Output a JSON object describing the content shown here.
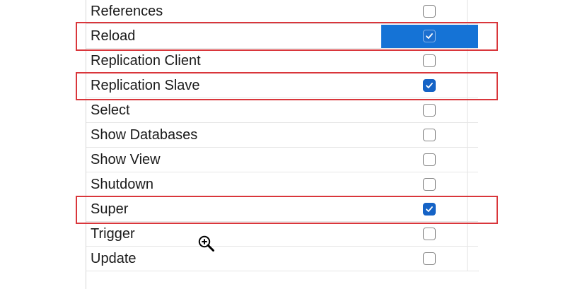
{
  "privileges": {
    "rows": [
      {
        "label": "References",
        "checked": false
      },
      {
        "label": "Reload",
        "checked": true
      },
      {
        "label": "Replication Client",
        "checked": false
      },
      {
        "label": "Replication Slave",
        "checked": true
      },
      {
        "label": "Select",
        "checked": false
      },
      {
        "label": "Show Databases",
        "checked": false
      },
      {
        "label": "Show View",
        "checked": false
      },
      {
        "label": "Shutdown",
        "checked": false
      },
      {
        "label": "Super",
        "checked": true
      },
      {
        "label": "Trigger",
        "checked": false
      },
      {
        "label": "Update",
        "checked": false
      }
    ],
    "selected_row": "Reload",
    "highlighted_rows": [
      "Reload",
      "Replication Slave",
      "Super"
    ]
  },
  "colors": {
    "selection": "#1573d6",
    "checkbox_checked": "#1563c6",
    "highlight_border": "#d9363b"
  },
  "cursor": {
    "icon": "zoom-in-icon"
  }
}
